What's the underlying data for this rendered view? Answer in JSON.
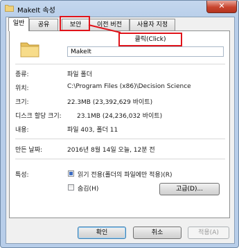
{
  "window": {
    "title": "MakeIt 속성",
    "close_glyph": "✕"
  },
  "tabs": [
    {
      "label": "일반",
      "active": true
    },
    {
      "label": "공유",
      "active": false
    },
    {
      "label": "보안",
      "active": false,
      "highlighted": true
    },
    {
      "label": "이전 버전",
      "active": false
    },
    {
      "label": "사용자 지정",
      "active": false
    }
  ],
  "general": {
    "folder_icon": "folder-icon",
    "name_value": "MakeIt",
    "rows": [
      {
        "key": "종류:",
        "value": "파일 폴더"
      },
      {
        "key": "위치:",
        "value": "C:\\Program Files (x86)\\Decision Science"
      },
      {
        "key": "크기:",
        "value": "22.3MB (23,392,629 바이트)"
      },
      {
        "key": "디스크 할당 크기:",
        "value": "23.1MB (24,236,032 바이트)"
      },
      {
        "key": "내용:",
        "value": "파일 403, 폴더 11"
      },
      {
        "key": "만든 날짜:",
        "value": "2016년 8월 14일 오늘, 12분 전"
      }
    ],
    "attributes_label": "특성:",
    "readonly_label": "읽기 전용(폴더의 파일에만 적용)(R)",
    "hidden_label": "숨김(H)",
    "advanced_label": "고급(D)..."
  },
  "buttons": {
    "ok": "확인",
    "cancel": "취소",
    "apply": "적용(A)"
  },
  "annotation": {
    "callout": "클릭(Click)",
    "color": "#e0131a"
  }
}
